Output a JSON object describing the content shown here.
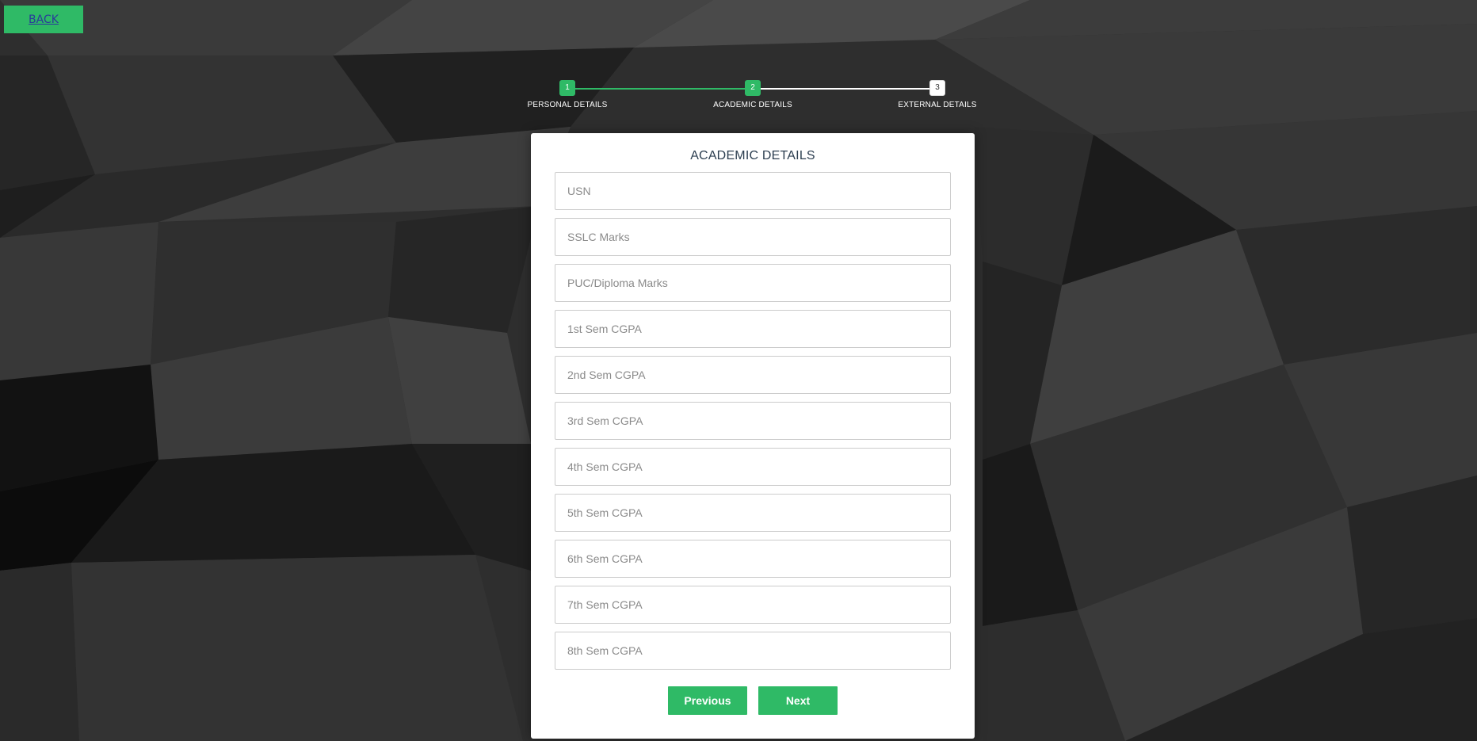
{
  "back_button": {
    "label": "BACK"
  },
  "progress": {
    "current_step": 2,
    "steps": [
      {
        "number": "1",
        "label": "PERSONAL DETAILS",
        "status": "done"
      },
      {
        "number": "2",
        "label": "ACADEMIC DETAILS",
        "status": "active"
      },
      {
        "number": "3",
        "label": "EXTERNAL DETAILS",
        "status": "todo"
      }
    ]
  },
  "form": {
    "title": "ACADEMIC DETAILS",
    "fields": [
      {
        "placeholder": "USN",
        "value": ""
      },
      {
        "placeholder": "SSLC Marks",
        "value": ""
      },
      {
        "placeholder": "PUC/Diploma Marks",
        "value": ""
      },
      {
        "placeholder": "1st Sem CGPA",
        "value": ""
      },
      {
        "placeholder": "2nd Sem CGPA",
        "value": ""
      },
      {
        "placeholder": "3rd Sem CGPA",
        "value": ""
      },
      {
        "placeholder": "4th Sem CGPA",
        "value": ""
      },
      {
        "placeholder": "5th Sem CGPA",
        "value": ""
      },
      {
        "placeholder": "6th Sem CGPA",
        "value": ""
      },
      {
        "placeholder": "7th Sem CGPA",
        "value": ""
      },
      {
        "placeholder": "8th Sem CGPA",
        "value": ""
      }
    ],
    "previous_label": "Previous",
    "next_label": "Next"
  },
  "colors": {
    "accent": "#2fba66",
    "background": "#2b2b2b",
    "card": "#ffffff",
    "title": "#2c3e50"
  }
}
